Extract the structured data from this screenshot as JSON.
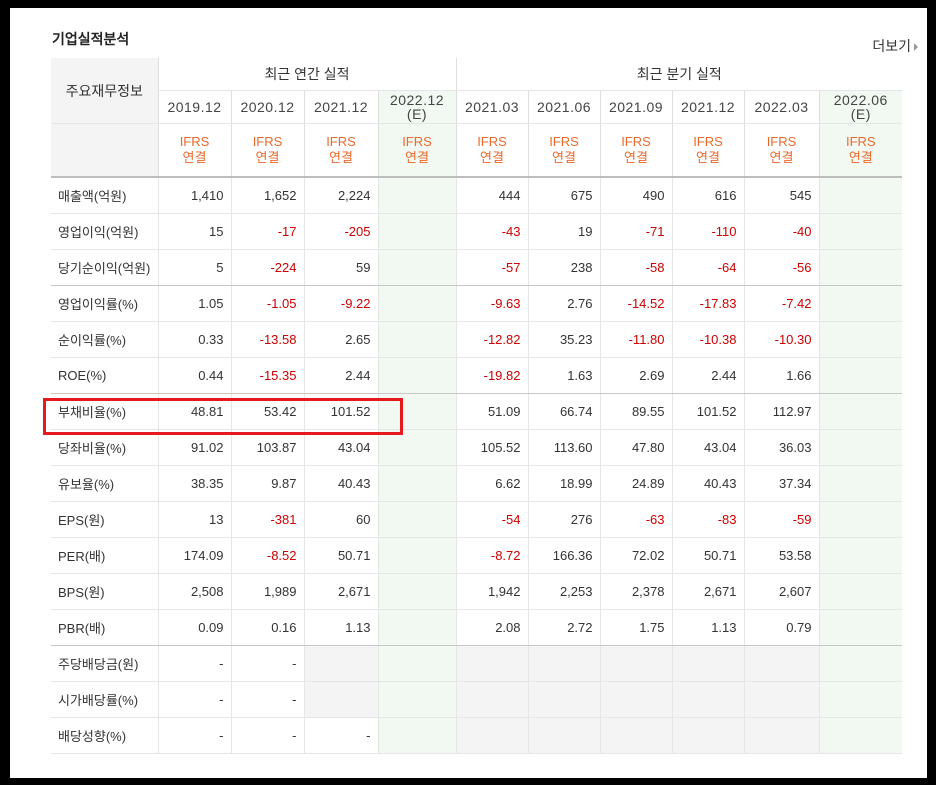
{
  "section_title": "기업실적분석",
  "more_link": "더보기",
  "header": {
    "label": "주요재무정보",
    "annual_group": "최근 연간 실적",
    "quarter_group": "최근 분기 실적",
    "periods": [
      "2019.12",
      "2020.12",
      "2021.12",
      "2022.12",
      "2021.03",
      "2021.06",
      "2021.09",
      "2021.12",
      "2022.03",
      "2022.06"
    ],
    "estimate_mark": "(E)",
    "ifrs": "IFRS",
    "consolidated": "연결"
  },
  "rows": [
    {
      "label": "매출액(억원)",
      "values": [
        "1,410",
        "1,652",
        "2,224",
        "",
        "444",
        "675",
        "490",
        "616",
        "545",
        ""
      ]
    },
    {
      "label": "영업이익(억원)",
      "values": [
        "15",
        "-17",
        "-205",
        "",
        "-43",
        "19",
        "-71",
        "-110",
        "-40",
        ""
      ]
    },
    {
      "label": "당기순이익(억원)",
      "values": [
        "5",
        "-224",
        "59",
        "",
        "-57",
        "238",
        "-58",
        "-64",
        "-56",
        ""
      ]
    },
    {
      "label": "영업이익률(%)",
      "values": [
        "1.05",
        "-1.05",
        "-9.22",
        "",
        "-9.63",
        "2.76",
        "-14.52",
        "-17.83",
        "-7.42",
        ""
      ]
    },
    {
      "label": "순이익률(%)",
      "values": [
        "0.33",
        "-13.58",
        "2.65",
        "",
        "-12.82",
        "35.23",
        "-11.80",
        "-10.38",
        "-10.30",
        ""
      ]
    },
    {
      "label": "ROE(%)",
      "values": [
        "0.44",
        "-15.35",
        "2.44",
        "",
        "-19.82",
        "1.63",
        "2.69",
        "2.44",
        "1.66",
        ""
      ]
    },
    {
      "label": "부채비율(%)",
      "values": [
        "48.81",
        "53.42",
        "101.52",
        "",
        "51.09",
        "66.74",
        "89.55",
        "101.52",
        "112.97",
        ""
      ]
    },
    {
      "label": "당좌비율(%)",
      "values": [
        "91.02",
        "103.87",
        "43.04",
        "",
        "105.52",
        "113.60",
        "47.80",
        "43.04",
        "36.03",
        ""
      ]
    },
    {
      "label": "유보율(%)",
      "values": [
        "38.35",
        "9.87",
        "40.43",
        "",
        "6.62",
        "18.99",
        "24.89",
        "40.43",
        "37.34",
        ""
      ]
    },
    {
      "label": "EPS(원)",
      "values": [
        "13",
        "-381",
        "60",
        "",
        "-54",
        "276",
        "-63",
        "-83",
        "-59",
        ""
      ]
    },
    {
      "label": "PER(배)",
      "values": [
        "174.09",
        "-8.52",
        "50.71",
        "",
        "-8.72",
        "166.36",
        "72.02",
        "50.71",
        "53.58",
        ""
      ]
    },
    {
      "label": "BPS(원)",
      "values": [
        "2,508",
        "1,989",
        "2,671",
        "",
        "1,942",
        "2,253",
        "2,378",
        "2,671",
        "2,607",
        ""
      ]
    },
    {
      "label": "PBR(배)",
      "values": [
        "0.09",
        "0.16",
        "1.13",
        "",
        "2.08",
        "2.72",
        "1.75",
        "1.13",
        "0.79",
        ""
      ]
    },
    {
      "label": "주당배당금(원)",
      "values": [
        "-",
        "-",
        "",
        "",
        "",
        "",
        "",
        "",
        "",
        ""
      ]
    },
    {
      "label": "시가배당률(%)",
      "values": [
        "-",
        "-",
        "",
        "",
        "",
        "",
        "",
        "",
        "",
        ""
      ]
    },
    {
      "label": "배당성향(%)",
      "values": [
        "-",
        "-",
        "-",
        "",
        "",
        "",
        "",
        "",
        "",
        ""
      ]
    }
  ],
  "highlight_color": "#e5191e"
}
